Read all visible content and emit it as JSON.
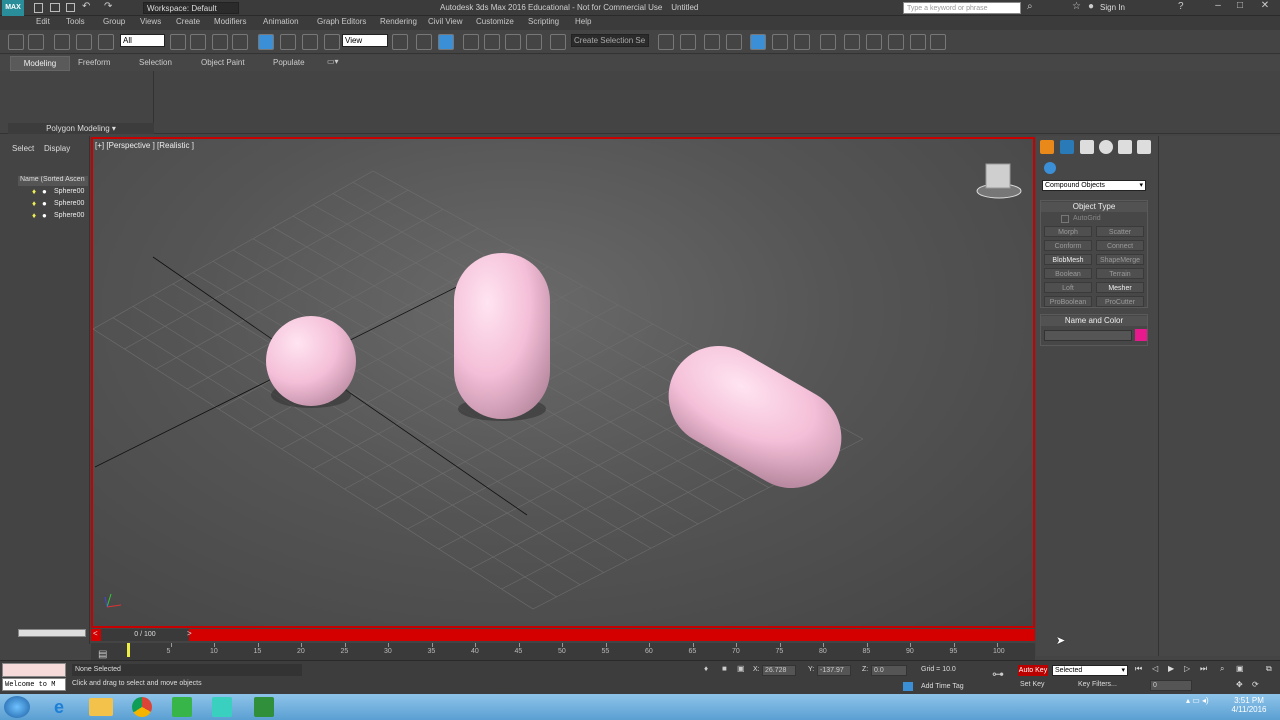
{
  "window": {
    "title": "Autodesk 3ds Max 2016 Educational - Not for Commercial Use    Untitled",
    "workspace": "Workspace: Default",
    "search_placeholder": "Type a keyword or phrase",
    "sign_in": "Sign In"
  },
  "menu": [
    "Edit",
    "Tools",
    "Group",
    "Views",
    "Create",
    "Modifiers",
    "Animation",
    "Graph Editors",
    "Rendering",
    "Civil View",
    "Customize",
    "Scripting",
    "Help"
  ],
  "toolbar": {
    "selection_filter": "All",
    "reference_coord": "View",
    "named_selection": "Create Selection Se"
  },
  "ribbon": {
    "tabs": [
      "Modeling",
      "Freeform",
      "Selection",
      "Object Paint",
      "Populate"
    ],
    "panel_label": "Polygon Modeling"
  },
  "scene_explorer": {
    "tabs": [
      "Select",
      "Display"
    ],
    "column_header": "Name (Sorted Ascen",
    "items": [
      "Sphere00",
      "Sphere00",
      "Sphere00"
    ]
  },
  "viewport": {
    "label": "[+] [Perspective ] [Realistic ]"
  },
  "command_panel": {
    "category": "Compound Objects",
    "object_type_title": "Object Type",
    "autogrid": "AutoGrid",
    "buttons": [
      "Morph",
      "Scatter",
      "Conform",
      "Connect",
      "BlobMesh",
      "ShapeMerge",
      "Boolean",
      "Terrain",
      "Loft",
      "Mesher",
      "ProBoolean",
      "ProCutter"
    ],
    "enabled": [
      false,
      false,
      false,
      false,
      true,
      false,
      false,
      false,
      false,
      true,
      false,
      false
    ],
    "name_color_title": "Name and Color",
    "color": "#e8198c"
  },
  "timeline": {
    "frame": "0 / 100",
    "ticks": [
      "5",
      "10",
      "15",
      "20",
      "25",
      "30",
      "35",
      "40",
      "45",
      "50",
      "55",
      "60",
      "65",
      "70",
      "75",
      "80",
      "85",
      "90",
      "95",
      "100"
    ]
  },
  "status": {
    "listener": "Welcome to M",
    "selection": "None Selected",
    "prompt": "Click and drag to select and move objects",
    "x_label": "X:",
    "x_value": "26.728",
    "y_label": "Y:",
    "y_value": "-137.97",
    "z_label": "Z:",
    "z_value": "0.0",
    "grid": "Grid = 10.0",
    "add_time_tag": "Add Time Tag",
    "auto_key": "Auto Key",
    "set_key": "Set Key",
    "key_mode": "Selected",
    "key_filters": "Key Filters...",
    "frame_field": "0"
  },
  "clock": {
    "time": "3:51 PM",
    "date": "4/11/2016"
  }
}
